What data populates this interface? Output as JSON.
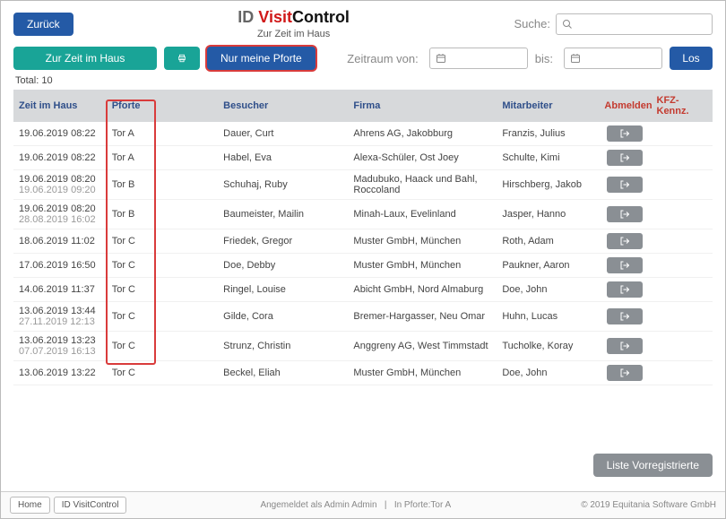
{
  "header": {
    "back_label": "Zurück",
    "title_id": "ID ",
    "title_visit": "Visit",
    "title_control": "Control",
    "subtitle": "Zur Zeit im Haus",
    "search_label": "Suche:",
    "search_placeholder": ""
  },
  "toolbar": {
    "current_label": "Zur Zeit im Haus",
    "only_my_gate_label": "Nur meine Pforte",
    "period_from_label": "Zeitraum von:",
    "period_to_label": "bis:",
    "go_label": "Los"
  },
  "summary": {
    "total_label": "Total: 10"
  },
  "columns": {
    "zeit": "Zeit im Haus",
    "pforte": "Pforte",
    "besucher": "Besucher",
    "firma": "Firma",
    "mitarbeiter": "Mitarbeiter",
    "abmelden": "Abmelden",
    "kfz": "KFZ-Kennz."
  },
  "rows": [
    {
      "zeit1": "19.06.2019 08:22",
      "zeit2": "",
      "pforte": "Tor A",
      "besucher": "Dauer, Curt",
      "firma": "Ahrens AG, Jakobburg",
      "mitarbeiter": "Franzis, Julius"
    },
    {
      "zeit1": "19.06.2019 08:22",
      "zeit2": "",
      "pforte": "Tor A",
      "besucher": "Habel, Eva",
      "firma": "Alexa-Schüler, Ost Joey",
      "mitarbeiter": "Schulte, Kimi"
    },
    {
      "zeit1": "19.06.2019 08:20",
      "zeit2": "19.06.2019 09:20",
      "pforte": "Tor B",
      "besucher": "Schuhaj, Ruby",
      "firma": "Madubuko, Haack und Bahl, Roccoland",
      "mitarbeiter": "Hirschberg, Jakob"
    },
    {
      "zeit1": "19.06.2019 08:20",
      "zeit2": "28.08.2019 16:02",
      "pforte": "Tor B",
      "besucher": "Baumeister, Mailin",
      "firma": "Minah-Laux, Evelinland",
      "mitarbeiter": "Jasper, Hanno"
    },
    {
      "zeit1": "18.06.2019 11:02",
      "zeit2": "",
      "pforte": "Tor C",
      "besucher": "Friedek, Gregor",
      "firma": "Muster GmbH, München",
      "mitarbeiter": "Roth, Adam"
    },
    {
      "zeit1": "17.06.2019 16:50",
      "zeit2": "",
      "pforte": "Tor C",
      "besucher": "Doe, Debby",
      "firma": "Muster GmbH, München",
      "mitarbeiter": "Paukner, Aaron"
    },
    {
      "zeit1": "14.06.2019 11:37",
      "zeit2": "",
      "pforte": "Tor C",
      "besucher": "Ringel, Louise",
      "firma": "Abicht GmbH, Nord Almaburg",
      "mitarbeiter": "Doe, John"
    },
    {
      "zeit1": "13.06.2019 13:44",
      "zeit2": "27.11.2019 12:13",
      "pforte": "Tor C",
      "besucher": "Gilde, Cora",
      "firma": "Bremer-Hargasser, Neu Omar",
      "mitarbeiter": "Huhn, Lucas"
    },
    {
      "zeit1": "13.06.2019 13:23",
      "zeit2": "07.07.2019 16:13",
      "pforte": "Tor C",
      "besucher": "Strunz, Christin",
      "firma": "Anggreny AG, West Timmstadt",
      "mitarbeiter": "Tucholke, Koray"
    },
    {
      "zeit1": "13.06.2019 13:22",
      "zeit2": "",
      "pforte": "Tor C",
      "besucher": "Beckel, Eliah",
      "firma": "Muster GmbH, München",
      "mitarbeiter": "Doe, John"
    }
  ],
  "footer": {
    "list_prereg_label": "Liste Vorregistrierte"
  },
  "bottombar": {
    "home": "Home",
    "app": "ID VisitControl",
    "logged_in": "Angemeldet als Admin Admin",
    "gate": "In Pforte:Tor A",
    "copyright": "© 2019 Equitania Software GmbH"
  },
  "colors": {
    "blue": "#245aa6",
    "teal": "#19a497",
    "gray": "#8a8f94",
    "highlight": "#d93b3b"
  }
}
